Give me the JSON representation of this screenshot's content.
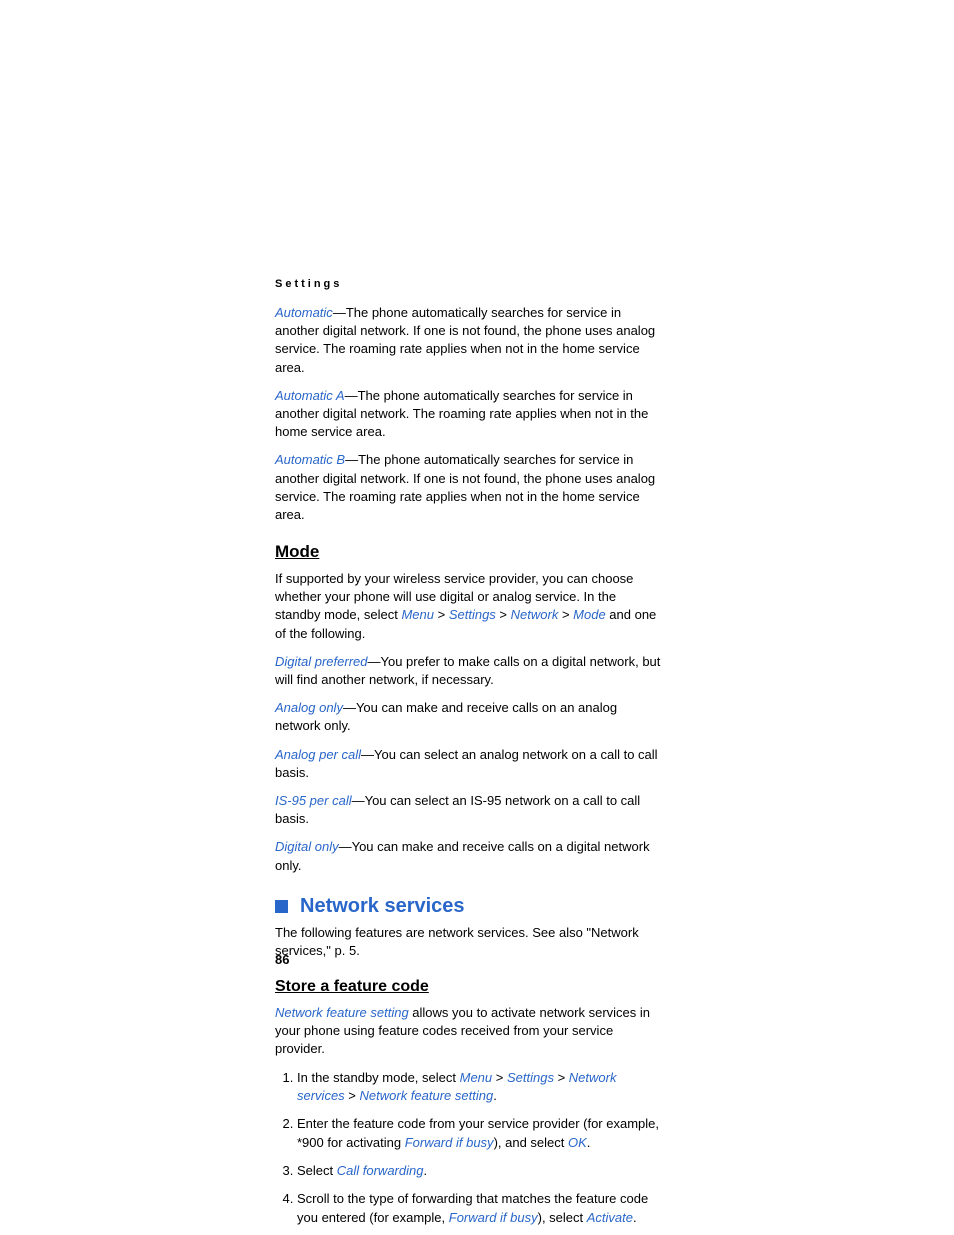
{
  "header": "Settings",
  "p1": {
    "term": "Automatic",
    "text": "—The phone automatically searches for service in another digital network. If one is not found, the phone uses analog service. The roaming rate applies when not in the home service area."
  },
  "p2": {
    "term": "Automatic A",
    "text": "—The phone automatically searches for service in another digital network. The roaming rate applies when not in the home service area."
  },
  "p3": {
    "term": "Automatic B",
    "text": "—The phone automatically searches for service in another digital network. If one is not found, the phone uses analog service. The roaming rate applies when not in the home service area."
  },
  "mode": {
    "title": "Mode",
    "intro1": "If supported by your wireless service provider, you can choose whether your phone will use digital or analog service. In the standby mode, select ",
    "menu": "Menu",
    "gt1": " > ",
    "settings": "Settings",
    "gt2": " > ",
    "network": "Network",
    "gt3": " > ",
    "modeLink": "Mode",
    "intro2": " and one of the following.",
    "dp": {
      "term": "Digital preferred",
      "text": "—You prefer to make calls on a digital network, but will find another network, if necessary."
    },
    "ao": {
      "term": "Analog only",
      "text": "—You can make and receive calls on an analog network only."
    },
    "apc": {
      "term": "Analog per call",
      "text": "—You can select an analog network on a call to call basis."
    },
    "is": {
      "term": "IS-95 per call",
      "text": "—You can select an IS-95 network on a call to call basis."
    },
    "do": {
      "term": "Digital only",
      "text": "—You can make and receive calls on a digital network only."
    }
  },
  "ns": {
    "title": "Network services",
    "desc": "The following features are network services. See also \"Network services,\" p. 5."
  },
  "sfc": {
    "title": "Store a feature code",
    "intro": {
      "term": "Network feature setting",
      "text": " allows you to activate network services in your phone using feature codes received from your service provider."
    },
    "li1a": "In the standby mode, select ",
    "li1_menu": "Menu",
    "li1_gt1": " > ",
    "li1_settings": "Settings",
    "li1_gt2": " > ",
    "li1_ns": "Network services",
    "li1_gt3": " > ",
    "li1_nfs": "Network feature setting",
    "li1_dot": ".",
    "li2a": "Enter the feature code from your service provider (for example, *900 for activating ",
    "li2_fib": "Forward if busy",
    "li2b": "), and select ",
    "li2_ok": "OK",
    "li2_dot": ".",
    "li3a": "Select ",
    "li3_cf": "Call forwarding",
    "li3_dot": ".",
    "li4a": "Scroll to the type of forwarding that matches the feature code you entered (for example, ",
    "li4_fib": "Forward if busy",
    "li4b": "), select ",
    "li4_act": "Activate",
    "li4_dot": "."
  },
  "pageNum": "86"
}
